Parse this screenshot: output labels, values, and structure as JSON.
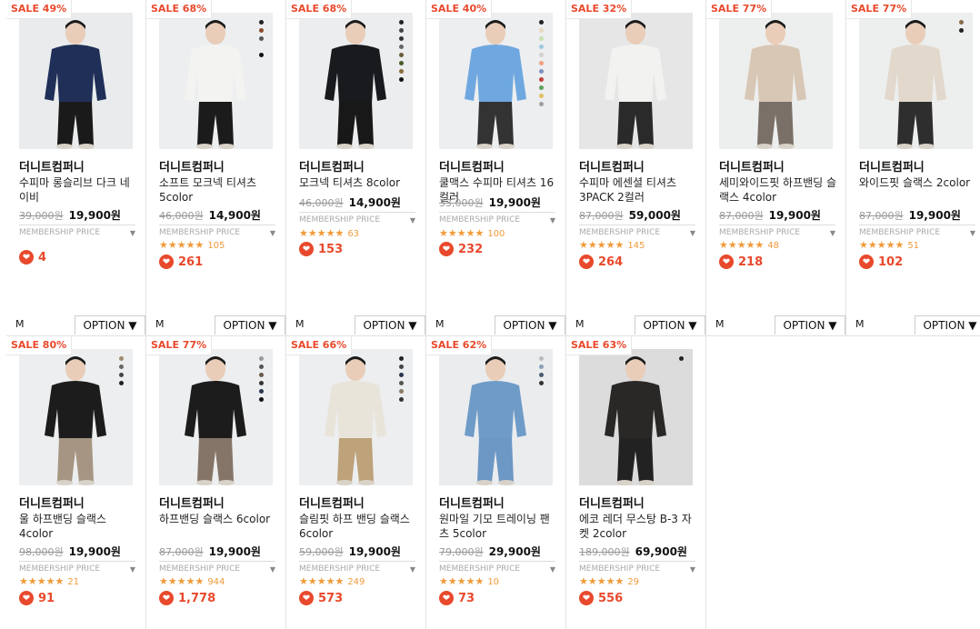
{
  "products": [
    {
      "sale": "SALE 49%",
      "brand": "더니트컴퍼니",
      "name": "수피마 롱슬리브 다크 네이비",
      "orig": "39,000원",
      "price": "19,900원",
      "member": "MEMBERSHIP PRICE",
      "stars": "",
      "reviews": "",
      "likes": "4",
      "size": "M",
      "option": "OPTION ▼",
      "swatches": [],
      "shirt": "#1f2f57",
      "pants": "#1a1a1a",
      "bg": "#e9ebed"
    },
    {
      "sale": "SALE 68%",
      "brand": "더니트컴퍼니",
      "name": "소프트 모크넥 티셔츠 5color",
      "orig": "46,000원",
      "price": "14,900원",
      "member": "MEMBERSHIP PRICE",
      "stars": "★★★★★",
      "reviews": "105",
      "likes": "261",
      "size": "M",
      "option": "OPTION ▼",
      "swatches": [
        "#222",
        "#8a4b2a",
        "#555",
        "#eee",
        "#111"
      ],
      "shirt": "#f3f3f1",
      "pants": "#1b1b1b",
      "bg": "#eceeef"
    },
    {
      "sale": "SALE 68%",
      "brand": "더니트컴퍼니",
      "name": "모크넥 티셔츠 8color",
      "orig": "46,000원",
      "price": "14,900원",
      "member": "MEMBERSHIP PRICE",
      "stars": "★★★★★",
      "reviews": "63",
      "likes": "153",
      "size": "M",
      "option": "OPTION ▼",
      "swatches": [
        "#222",
        "#444",
        "#333",
        "#666",
        "#6b5a3a",
        "#4a5a2a",
        "#8a6b3a",
        "#111"
      ],
      "shirt": "#181a1e",
      "pants": "#181818",
      "bg": "#ecedee"
    },
    {
      "sale": "SALE 40%",
      "brand": "더니트컴퍼니",
      "name": "쿨맥스 수피마 티셔츠 16컬러",
      "orig": "33,000원",
      "price": "19,900원",
      "member": "MEMBERSHIP PRICE",
      "stars": "★★★★★",
      "reviews": "100",
      "likes": "232",
      "size": "M",
      "option": "OPTION ▼",
      "swatches": [
        "#222",
        "#e8d9c0",
        "#c8e0b0",
        "#a0c8e0",
        "#d0d0d0",
        "#f0a080",
        "#8090c0",
        "#c04040",
        "#60a060",
        "#e0c060",
        "#a0a0a0"
      ],
      "shirt": "#6fa8e0",
      "pants": "#333",
      "bg": "#eceeef"
    },
    {
      "sale": "SALE 32%",
      "brand": "더니트컴퍼니",
      "name": "수피마 에센셜 티셔츠 3PACK 2컬러",
      "orig": "87,000원",
      "price": "59,000원",
      "member": "MEMBERSHIP PRICE",
      "stars": "★★★★★",
      "reviews": "145",
      "likes": "264",
      "size": "M",
      "option": "OPTION ▼",
      "swatches": [],
      "shirt": "#f2f2f0",
      "pants": "#2a2a2a",
      "bg": "#e6e6e6"
    },
    {
      "sale": "SALE 77%",
      "brand": "더니트컴퍼니",
      "name": "세미와이드핏 하프밴딩 슬랙스 4color",
      "orig": "87,000원",
      "price": "19,900원",
      "member": "MEMBERSHIP PRICE",
      "stars": "★★★★★",
      "reviews": "48",
      "likes": "218",
      "size": "M",
      "option": "OPTION ▼",
      "swatches": [],
      "shirt": "#d8c7b4",
      "pants": "#7a7068",
      "bg": "#edeeee"
    },
    {
      "sale": "SALE 77%",
      "brand": "더니트컴퍼니",
      "name": "와이드핏 슬랙스 2color",
      "orig": "87,000원",
      "price": "19,900원",
      "member": "MEMBERSHIP PRICE",
      "stars": "★★★★★",
      "reviews": "51",
      "likes": "102",
      "size": "M",
      "option": "OPTION ▼",
      "swatches": [
        "#8a6b4a",
        "#222"
      ],
      "shirt": "#e2d8cc",
      "pants": "#2e2e2e",
      "bg": "#edeeee"
    },
    {
      "sale": "SALE 80%",
      "brand": "더니트컴퍼니",
      "name": "울 하프밴딩 슬랙스 4color",
      "orig": "98,000원",
      "price": "19,900원",
      "member": "MEMBERSHIP PRICE",
      "stars": "★★★★★",
      "reviews": "21",
      "likes": "91",
      "size": "",
      "option": "",
      "swatches": [
        "#a08a70",
        "#666",
        "#444",
        "#222"
      ],
      "shirt": "#1c1c1c",
      "pants": "#a69582",
      "bg": "#eceeef"
    },
    {
      "sale": "SALE 77%",
      "brand": "더니트컴퍼니",
      "name": "하프밴딩 슬랙스 6color",
      "orig": "87,000원",
      "price": "19,900원",
      "member": "MEMBERSHIP PRICE",
      "stars": "★★★★★",
      "reviews": "944",
      "likes": "1,778",
      "size": "",
      "option": "",
      "swatches": [
        "#999",
        "#555",
        "#6a5a4a",
        "#333",
        "#2a3550",
        "#111"
      ],
      "shirt": "#1c1c1c",
      "pants": "#857568",
      "bg": "#eceeef"
    },
    {
      "sale": "SALE 66%",
      "brand": "더니트컴퍼니",
      "name": "슬림핏 하프 밴딩 슬랙스 6color",
      "orig": "59,000원",
      "price": "19,900원",
      "member": "MEMBERSHIP PRICE",
      "stars": "★★★★★",
      "reviews": "249",
      "likes": "573",
      "size": "",
      "option": "",
      "swatches": [
        "#222",
        "#444",
        "#2a3550",
        "#555",
        "#8a7a6a",
        "#333"
      ],
      "shirt": "#e9e4da",
      "pants": "#bda27a",
      "bg": "#eceeef"
    },
    {
      "sale": "SALE 62%",
      "brand": "더니트컴퍼니",
      "name": "원마일 기모 트레이닝 팬츠 5color",
      "orig": "79,000원",
      "price": "29,900원",
      "member": "MEMBERSHIP PRICE",
      "stars": "★★★★★",
      "reviews": "10",
      "likes": "73",
      "size": "",
      "option": "",
      "swatches": [
        "#bbb",
        "#8aa0b8",
        "#4a5a70",
        "#333"
      ],
      "shirt": "#6f9bc8",
      "pants": "#6d97c4",
      "bg": "#eaecee"
    },
    {
      "sale": "SALE 63%",
      "brand": "더니트컴퍼니",
      "name": "에코 레더 무스탕 B-3 자켓 2color",
      "orig": "189,000원",
      "price": "69,900원",
      "member": "MEMBERSHIP PRICE",
      "stars": "★★★★★",
      "reviews": "29",
      "likes": "556",
      "size": "",
      "option": "",
      "swatches": [
        "#222"
      ],
      "shirt": "#2a2826",
      "pants": "#222",
      "bg": "#dcdcdc"
    }
  ]
}
